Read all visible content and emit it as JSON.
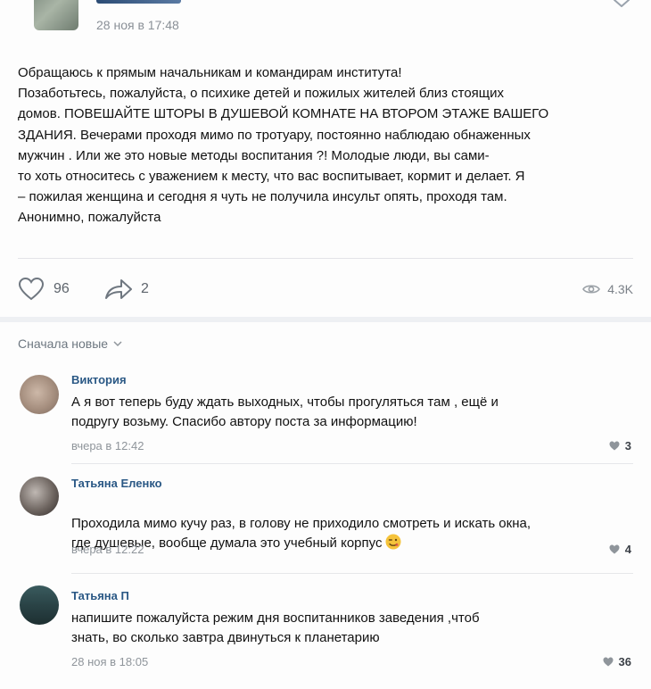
{
  "post": {
    "date": "28 ноя в 17:48",
    "text": "Обращаюсь к прямым начальникам и командирам института!\nПозаботьтесь, пожалуйста, о психике детей и пожилых жителей близ стоящих\nдомов. ПОВЕШАЙТЕ ШТОРЫ В ДУШЕВОЙ КОМНАТЕ НА ВТОРОМ ЭТАЖЕ ВАШЕГО\nЗДАНИЯ. Вечерами проходя мимо по тротуару, постоянно наблюдаю обнаженных\n мужчин . Или же это новые методы воспитания ?! Молодые люди, вы сами-\nто хоть относитесь с уважением к месту, что вас воспитывает, кормит и делает. Я\n– пожилая женщина и сегодня я чуть не получила инсульт опять, проходя там.\nАнонимно, пожалуйста",
    "likes": "96",
    "shares": "2",
    "views": "4.3K",
    "icons": {
      "like": "heart-icon",
      "share": "share-arrow-icon",
      "views": "eye-icon",
      "more": "chevron-down-icon"
    }
  },
  "comments_sort": {
    "label": "Сначала новые"
  },
  "comments": [
    {
      "author": "Виктория",
      "text": "А я вот теперь буду ждать выходных, чтобы прогуляться там , ещё и\nподругу возьму. Спасибо автору поста за информацию!",
      "date": "вчера в 12:42",
      "likes": "3"
    },
    {
      "author": "Татьяна Еленко",
      "text": "Проходила мимо кучу раз, в голову не приходило смотреть и искать окна,\nгде душевые, вообще думала это учебный корпус",
      "emoji": "winking-face-emoji",
      "date": "вчера в 12:22",
      "likes": "4"
    },
    {
      "author": "Татьяна П",
      "text": "напишите пожалуйста режим дня воспитанников заведения ,чтоб\nзнать, во сколько завтра двинуться к планетарию",
      "date": "28 ноя в 18:05",
      "likes": "36"
    }
  ],
  "colors": {
    "link": "#2a5885",
    "muted": "#8f959b",
    "divider": "#e6e7ea",
    "section_bg": "#eef0f3"
  }
}
